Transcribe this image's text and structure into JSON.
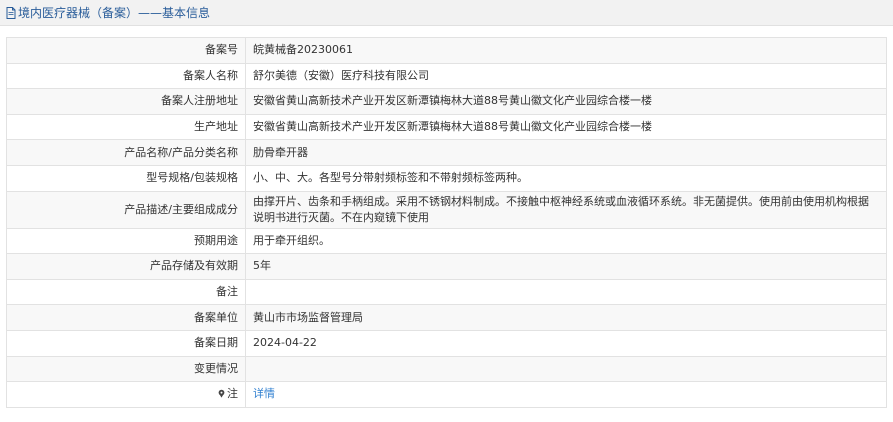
{
  "header": {
    "title": "境内医疗器械（备案）——基本信息",
    "icon": "document-icon",
    "accent": "#2a5d9a"
  },
  "rows": [
    {
      "label": "备案号",
      "value": "皖黄械备20230061"
    },
    {
      "label": "备案人名称",
      "value": "舒尔美德（安徽）医疗科技有限公司"
    },
    {
      "label": "备案人注册地址",
      "value": "安徽省黄山高新技术产业开发区新潭镇梅林大道88号黄山徽文化产业园综合楼一楼"
    },
    {
      "label": "生产地址",
      "value": "安徽省黄山高新技术产业开发区新潭镇梅林大道88号黄山徽文化产业园综合楼一楼"
    },
    {
      "label": "产品名称/产品分类名称",
      "value": "肋骨牵开器"
    },
    {
      "label": "型号规格/包装规格",
      "value": "小、中、大。各型号分带射频标签和不带射频标签两种。"
    },
    {
      "label": "产品描述/主要组成成分",
      "value": "由撑开片、齿条和手柄组成。采用不锈钢材料制成。不接触中枢神经系统或血液循环系统。非无菌提供。使用前由使用机构根据说明书进行灭菌。不在内窥镜下使用"
    },
    {
      "label": "预期用途",
      "value": "用于牵开组织。"
    },
    {
      "label": "产品存储及有效期",
      "value": "5年"
    },
    {
      "label": "备注",
      "value": ""
    },
    {
      "label": "备案单位",
      "value": "黄山市市场监督管理局"
    },
    {
      "label": "备案日期",
      "value": "2024-04-22"
    },
    {
      "label": "变更情况",
      "value": ""
    }
  ],
  "note_row": {
    "label": "注",
    "link_text": "详情",
    "icon": "location-pin-icon",
    "link_color": "#2f7fd0"
  }
}
